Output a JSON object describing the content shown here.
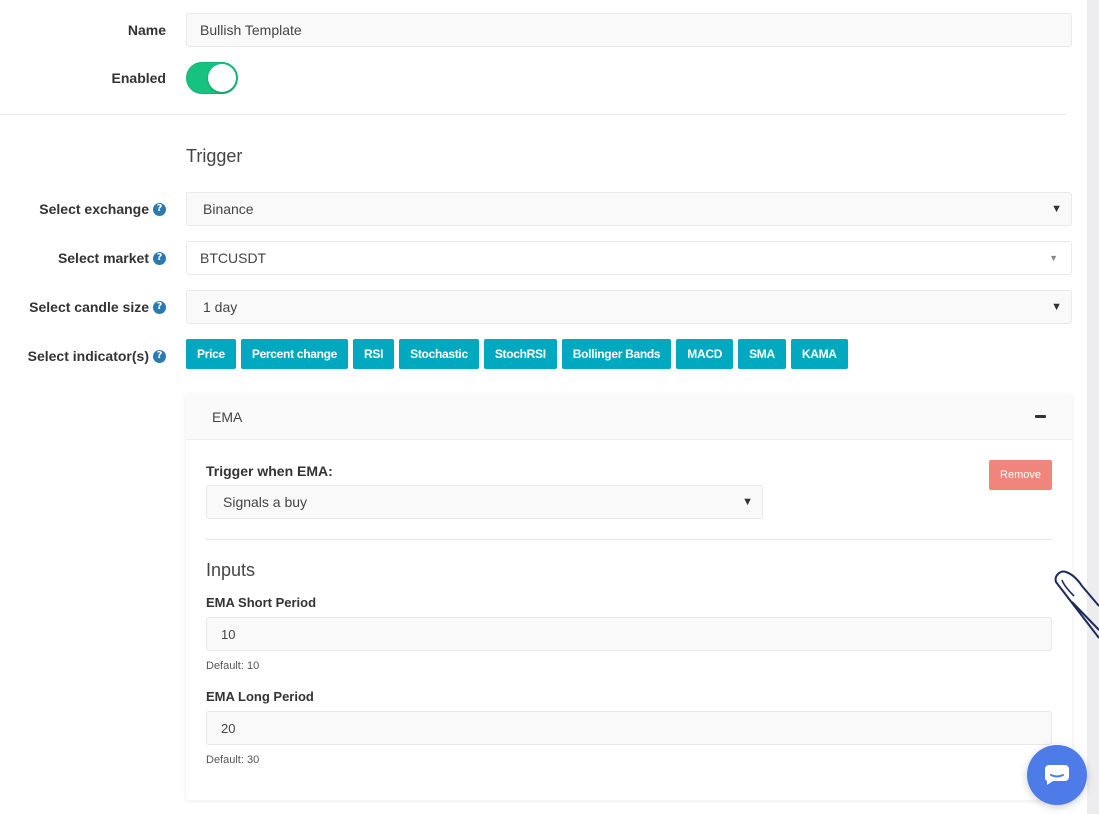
{
  "form": {
    "name_label": "Name",
    "name_value": "Bullish Template",
    "enabled_label": "Enabled",
    "enabled_state": true
  },
  "trigger": {
    "section_title": "Trigger",
    "exchange_label": "Select exchange",
    "exchange_value": "Binance",
    "market_label": "Select market",
    "market_value": "BTCUSDT",
    "candle_label": "Select candle size",
    "candle_value": "1 day",
    "indicators_label": "Select indicator(s)",
    "indicators": [
      {
        "label": "Price"
      },
      {
        "label": "Percent change"
      },
      {
        "label": "RSI"
      },
      {
        "label": "Stochastic"
      },
      {
        "label": "StochRSI"
      },
      {
        "label": "Bollinger Bands"
      },
      {
        "label": "MACD"
      },
      {
        "label": "SMA"
      },
      {
        "label": "KAMA"
      }
    ]
  },
  "ema_panel": {
    "title": "EMA",
    "trigger_label": "Trigger when EMA:",
    "trigger_value": "Signals a buy",
    "remove_label": "Remove",
    "inputs_title": "Inputs",
    "short_label": "EMA Short Period",
    "short_value": "10",
    "short_default": "Default: 10",
    "long_label": "EMA Long Period",
    "long_value": "20",
    "long_default": "Default: 30"
  },
  "icons": {
    "help": "question-circle-icon",
    "collapse": "minus-icon",
    "chat": "chat-icon",
    "cursor": "hand-pointer-icon"
  },
  "colors": {
    "toggle_on": "#16c27f",
    "chip": "#00a8c0",
    "remove": "#f0857c",
    "help_icon": "#2a7ab0",
    "chat": "#4d7be8"
  }
}
